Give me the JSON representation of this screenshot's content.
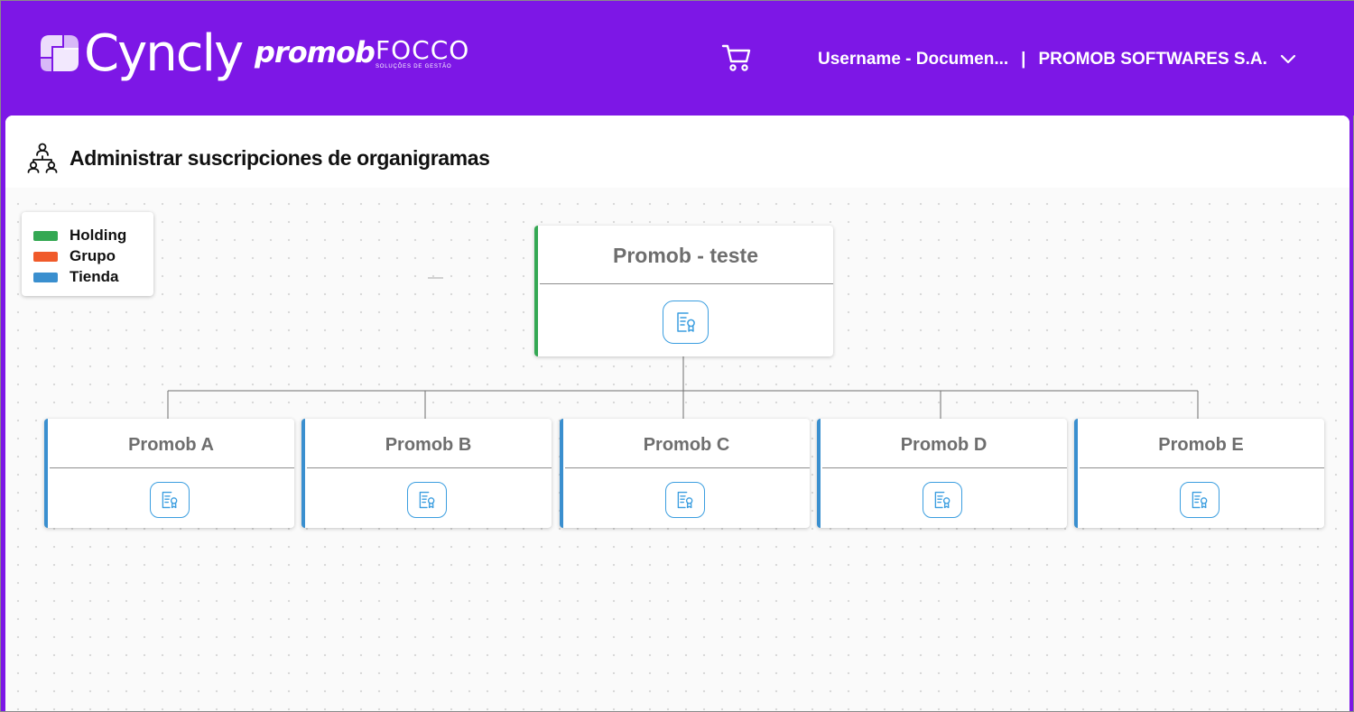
{
  "header": {
    "brand_logo": "Cyncly",
    "partner_logo_1": "promob",
    "partner_logo_2": "FOCCO",
    "partner_logo_2_tagline": "SOLUÇÕES DE GESTÃO",
    "cart_icon": "cart-icon",
    "username": "Username - Documen...",
    "separator": "|",
    "company": "PROMOB SOFTWARES S.A."
  },
  "page": {
    "title": "Administrar suscripciones de organigramas",
    "title_icon": "org-chart-users-icon"
  },
  "legend": [
    {
      "label": "Holding",
      "color": "#34a853"
    },
    {
      "label": "Grupo",
      "color": "#f05a2a"
    },
    {
      "label": "Tienda",
      "color": "#3a8fcf"
    }
  ],
  "org": {
    "root": {
      "name": "Promob - teste",
      "type": "Holding"
    },
    "children": [
      {
        "name": "Promob A",
        "type": "Tienda"
      },
      {
        "name": "Promob B",
        "type": "Tienda"
      },
      {
        "name": "Promob C",
        "type": "Tienda"
      },
      {
        "name": "Promob D",
        "type": "Tienda"
      },
      {
        "name": "Promob E",
        "type": "Tienda"
      }
    ]
  },
  "colors": {
    "header_bg": "#7d17e6",
    "holding": "#34a853",
    "grupo": "#f05a2a",
    "tienda": "#3a8fcf",
    "cert_icon": "#3b9ee0"
  }
}
